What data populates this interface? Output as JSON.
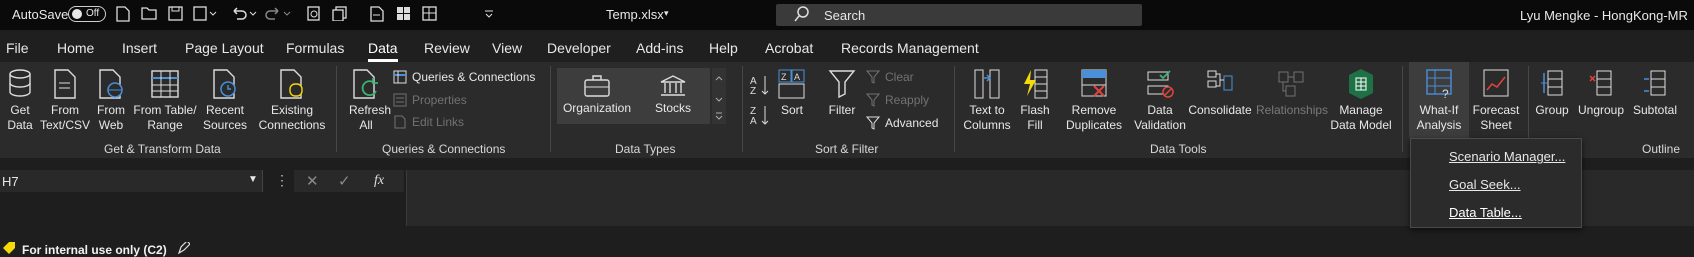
{
  "titlebar": {
    "autosave_label": "AutoSave",
    "autosave_state": "Off",
    "filename": "Temp.xlsx",
    "search_placeholder": "Search",
    "user": "Lyu Mengke - HongKong-MR"
  },
  "tabs": [
    "File",
    "Home",
    "Insert",
    "Page Layout",
    "Formulas",
    "Data",
    "Review",
    "View",
    "Developer",
    "Add-ins",
    "Help",
    "Acrobat",
    "Records Management"
  ],
  "active_tab": "Data",
  "ribbon": {
    "get_data": "Get Data",
    "from_text_csv": "From Text/CSV",
    "from_web": "From Web",
    "from_table_range": "From Table/ Range",
    "recent_sources": "Recent Sources",
    "existing_connections": "Existing Connections",
    "group_get_transform": "Get & Transform Data",
    "refresh_all": "Refresh All",
    "queries_connections": "Queries & Connections",
    "properties": "Properties",
    "edit_links": "Edit Links",
    "group_queries": "Queries & Connections",
    "organization": "Organization",
    "stocks": "Stocks",
    "group_data_types": "Data Types",
    "sort": "Sort",
    "filter": "Filter",
    "clear": "Clear",
    "reapply": "Reapply",
    "advanced": "Advanced",
    "group_sort_filter": "Sort & Filter",
    "text_to_columns": "Text to Columns",
    "flash_fill": "Flash Fill",
    "remove_duplicates": "Remove Duplicates",
    "data_validation": "Data Validation",
    "consolidate": "Consolidate",
    "relationships": "Relationships",
    "manage_data_model": "Manage Data Model",
    "group_data_tools": "Data Tools",
    "what_if": "What-If Analysis",
    "forecast_sheet": "Forecast Sheet",
    "group": "Group",
    "ungroup": "Ungroup",
    "subtotal": "Subtotal",
    "group_outline": "Outline"
  },
  "namebox": {
    "value": "H7"
  },
  "formula": {
    "fx": "fx"
  },
  "dropdown": {
    "items": [
      "Scenario Manager...",
      "Goal Seek...",
      "Data Table..."
    ]
  },
  "status": {
    "sensitivity": "For internal use only (C2)"
  },
  "colors": {
    "accent_green": "#1e7145",
    "yellow": "#f5d90a",
    "blue": "#4a8fd8",
    "red": "#e0443a"
  }
}
